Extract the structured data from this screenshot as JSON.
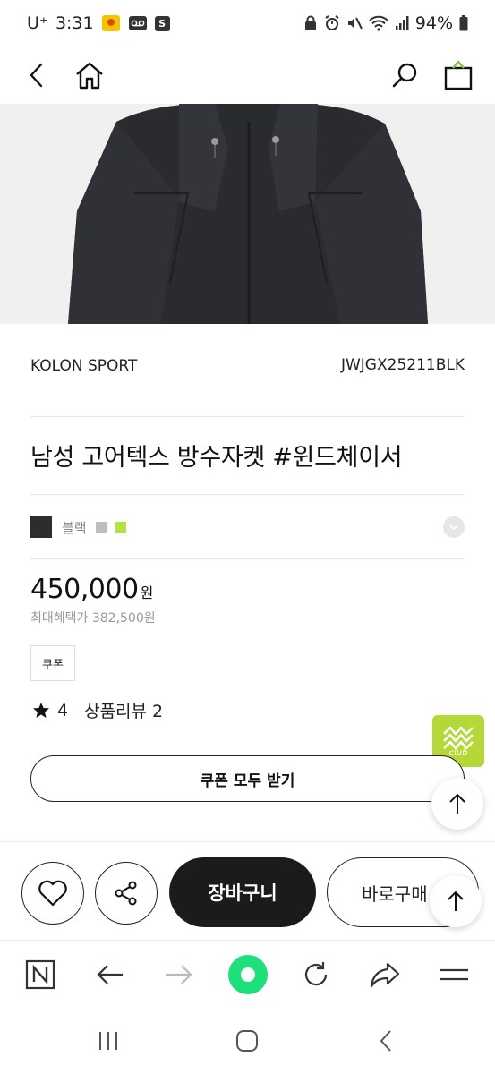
{
  "status_bar": {
    "carrier": "U⁺",
    "time": "3:31",
    "battery": "94%"
  },
  "header": {
    "back_icon": "chevron-left-icon",
    "home_icon": "home-icon",
    "search_icon": "search-icon",
    "bag_icon": "shopping-bag-icon"
  },
  "product": {
    "brand": "KOLON SPORT",
    "code": "JWJGX25211BLK",
    "title": "남성 고어텍스 방수자켓 #윈드체이서",
    "color": {
      "selected_name": "블랙",
      "selected_hex": "#2d2d30",
      "other_swatches": [
        "#bdbdbd",
        "#b3e33d"
      ]
    },
    "price": "450,000",
    "price_unit": "원",
    "max_benefit": "최대혜택가 382,500원",
    "coupon_tag": "쿠폰",
    "rating": "4",
    "review_label": "상품리뷰 2",
    "coupon_all_button": "쿠폰 모두 받기"
  },
  "floating": {
    "club_label": "club",
    "club_color": "#b3d838"
  },
  "action_bar": {
    "cart_label": "장바구니",
    "buy_label": "바로구매"
  },
  "browser_bar": {
    "accent": "#1ee07a"
  }
}
